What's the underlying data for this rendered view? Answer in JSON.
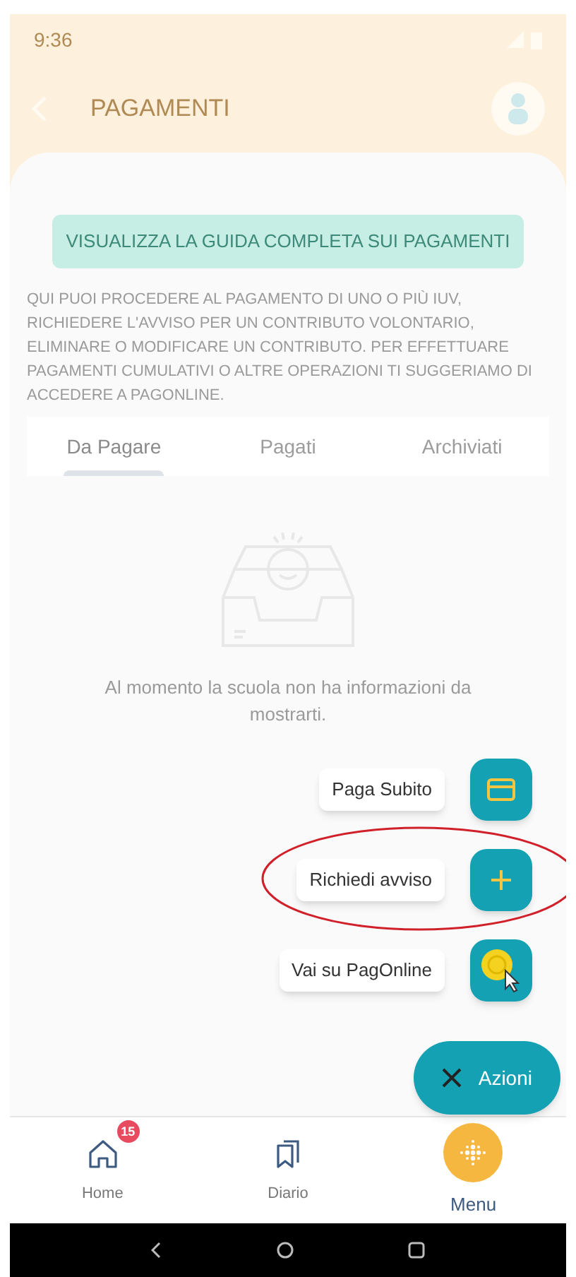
{
  "status_bar": {
    "time": "9:36"
  },
  "header": {
    "title": "PAGAMENTI"
  },
  "guide_button": "VISUALIZZA LA GUIDA COMPLETA SUI PAGAMENTI",
  "description": "QUI PUOI PROCEDERE AL PAGAMENTO DI UNO O PIÙ IUV, RICHIEDERE L'AVVISO PER UN CONTRIBUTO VOLONTARIO, ELIMINARE O MODIFICARE UN CONTRIBUTO. PER EFFETTUARE PAGAMENTI CUMULATIVI O ALTRE OPERAZIONI TI SUGGERIAMO DI ACCEDERE A PAGONLINE.",
  "tabs": [
    {
      "label": "Da Pagare",
      "selected": true
    },
    {
      "label": "Pagati",
      "selected": false
    },
    {
      "label": "Archiviati",
      "selected": false
    }
  ],
  "empty_message": "Al momento la scuola non ha informazioni da mostrarti.",
  "fab_actions": [
    {
      "kind": "card",
      "label": "Paga Subito",
      "highlighted": false
    },
    {
      "kind": "plus",
      "label": "Richiedi avviso",
      "highlighted": true
    },
    {
      "kind": "coin",
      "label": "Vai su PagOnline",
      "highlighted": false
    }
  ],
  "fab": {
    "label": "Azioni"
  },
  "bottom_nav": [
    {
      "kind": "home",
      "label": "Home",
      "badge": "15",
      "selected": false
    },
    {
      "kind": "diary",
      "label": "Diario",
      "selected": false
    },
    {
      "kind": "menu",
      "label": "Menu",
      "selected": true
    }
  ]
}
